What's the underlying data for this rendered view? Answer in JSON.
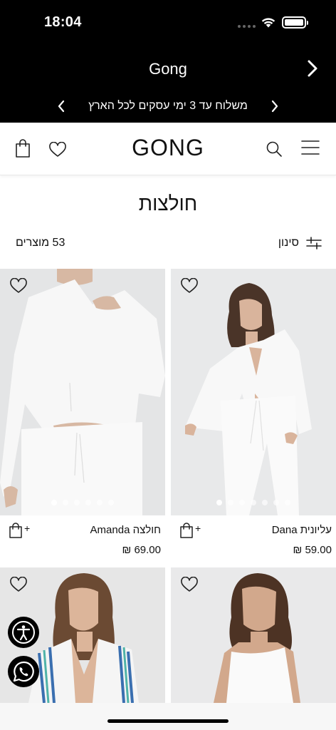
{
  "status": {
    "time": "18:04"
  },
  "topbar": {
    "store_name": "Gong",
    "promo_text": "משלוח עד 3 ימי עסקים לכל הארץ"
  },
  "header": {
    "logo": "GONG",
    "icons": [
      "bag-icon",
      "heart-icon",
      "search-icon",
      "menu-icon"
    ]
  },
  "page": {
    "title": "חולצות",
    "product_count": "53 מוצרים",
    "filter_label": "סינון"
  },
  "products": [
    {
      "name": "חולצה Amanda",
      "price": "69.00 ₪",
      "image_count": 6,
      "active_image": 0
    },
    {
      "name": "עליונית Dana",
      "price": "59.00 ₪",
      "image_count": 7,
      "active_image": 0
    },
    {
      "name": "",
      "price": ""
    },
    {
      "name": "",
      "price": ""
    }
  ],
  "floating": [
    "accessibility-icon",
    "whatsapp-icon"
  ],
  "colors": {
    "topbar": "#000000",
    "background": "#ffffff",
    "photo_bg": "#e8e9ea"
  }
}
